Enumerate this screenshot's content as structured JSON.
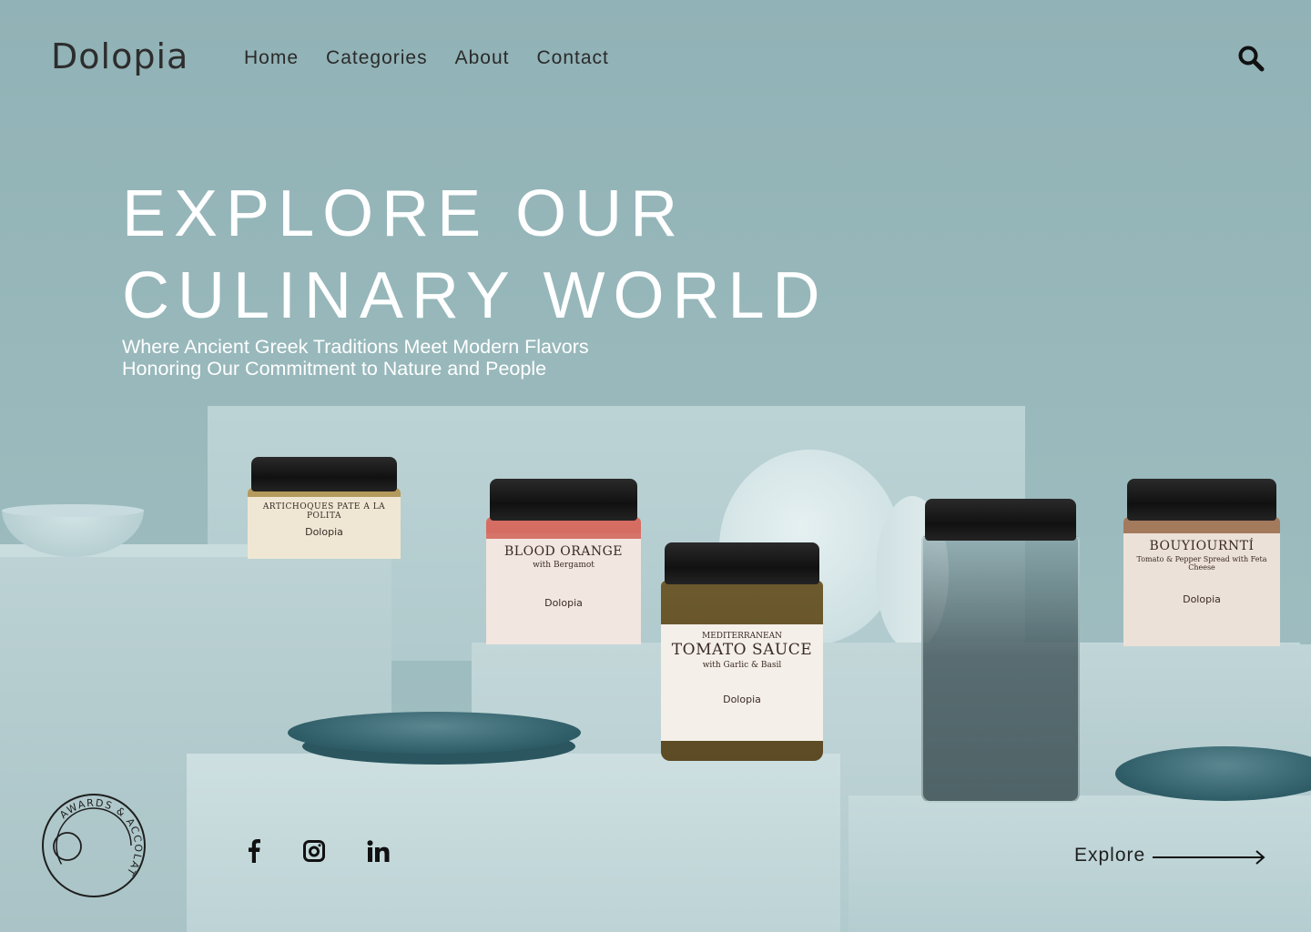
{
  "brand": {
    "logo_text": "Dolopia"
  },
  "nav": {
    "items": [
      "Home",
      "Categories",
      "About",
      "Contact"
    ]
  },
  "hero": {
    "title_line1": "EXPLORE OUR",
    "title_line2": "CULINARY WORLD",
    "subtitle_line1": "Where Ancient Greek Traditions Meet Modern Flavors",
    "subtitle_line2": "Honoring Our Commitment to Nature and People"
  },
  "products": {
    "artichoke": {
      "title": "ARTICHOQUES PATE A LA POLITA",
      "brand": "Dolopia"
    },
    "blood_orange": {
      "title": "BLOOD ORANGE",
      "subtitle": "with Bergamot",
      "brand": "Dolopia"
    },
    "tomato": {
      "kicker": "MEDITERRANEAN",
      "title": "TOMATO SAUCE",
      "subtitle": "with Garlic & Basil",
      "brand": "Dolopia"
    },
    "bouyiourti": {
      "title": "BOUYIOURNTÍ",
      "subtitle": "Tomato & Pepper Spread with Feta Cheese",
      "brand": "Dolopia"
    }
  },
  "awards": {
    "label": "AWARDS & ACCOLATES"
  },
  "social": {
    "icons": [
      "facebook-icon",
      "instagram-icon",
      "linkedin-icon"
    ]
  },
  "cta": {
    "explore_label": "Explore"
  },
  "colors": {
    "background": "#9fbcbf",
    "text_dark": "#2a2a2a",
    "hero_text": "#ffffff",
    "dish_teal": "#2f5d67"
  }
}
